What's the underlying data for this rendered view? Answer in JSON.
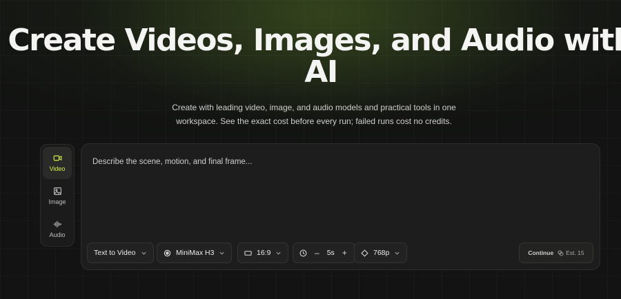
{
  "hero": {
    "title": "Create Videos, Images, and Audio with AI",
    "subtitle": "Create with leading video, image, and audio models and practical tools in one workspace. See the exact cost before every run; failed runs cost no credits."
  },
  "rail": {
    "items": [
      {
        "label": "Video",
        "icon": "video-camera-icon",
        "active": true
      },
      {
        "label": "Image",
        "icon": "image-icon",
        "active": false
      },
      {
        "label": "Audio",
        "icon": "audio-wave-icon",
        "active": false
      }
    ]
  },
  "composer": {
    "placeholder": "Describe the scene, motion, and final frame...",
    "mode": "Text to Video",
    "model": "MiniMax H3",
    "aspect_ratio": "16:9",
    "duration": "5s",
    "duration_minus": "–",
    "duration_plus": "+",
    "resolution": "768p",
    "continue_label": "Continue",
    "estimate": "Est. 15"
  },
  "colors": {
    "accent": "#d6f04a",
    "background": "#121312",
    "panel": "#1c1d1c"
  }
}
